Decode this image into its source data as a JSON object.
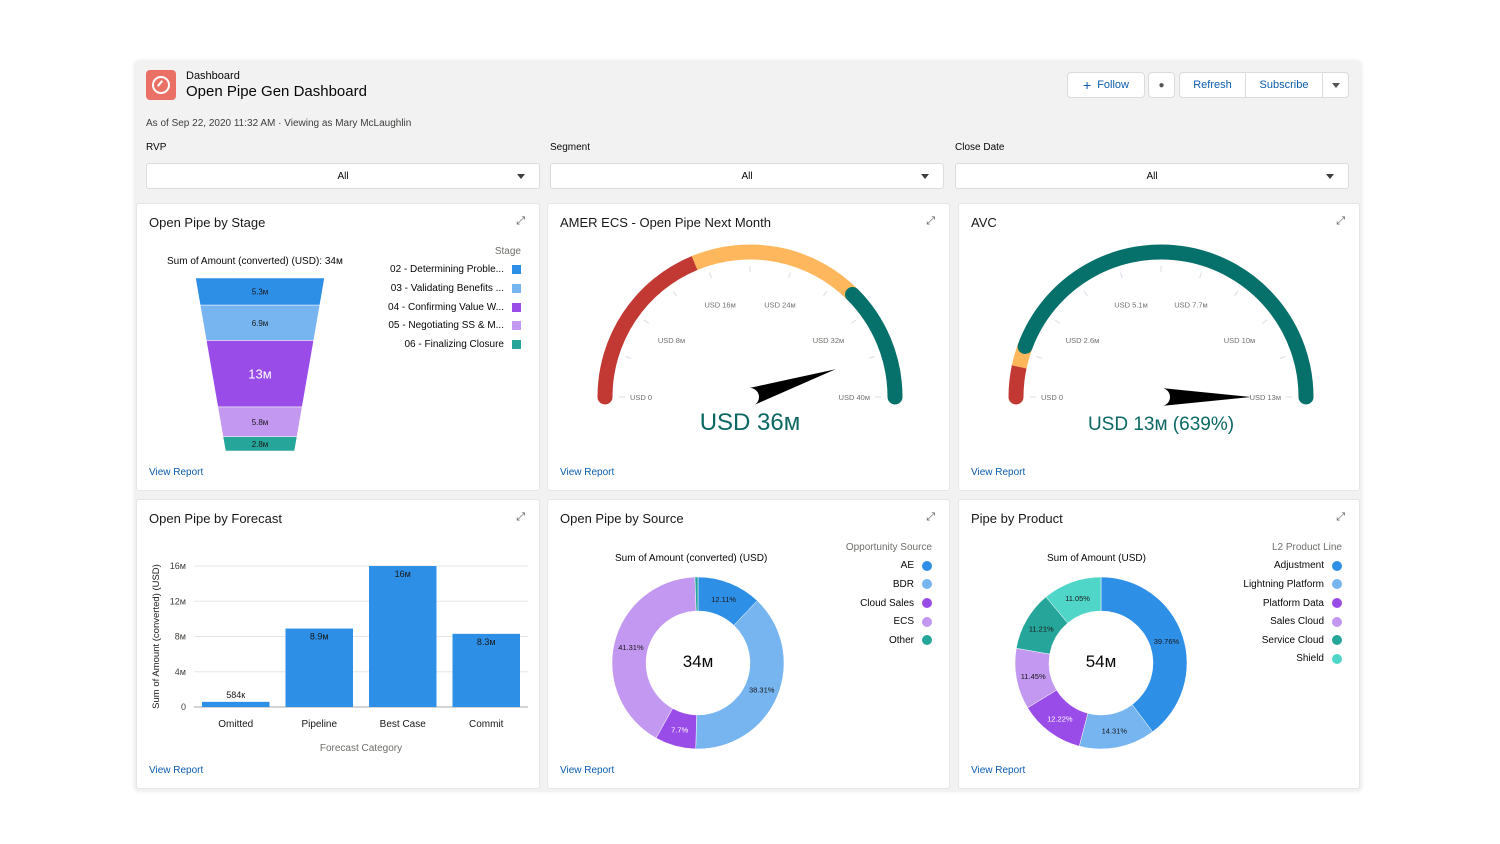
{
  "header": {
    "breadcrumb": "Dashboard",
    "title": "Open Pipe Gen Dashboard",
    "as_of": "As of Sep 22, 2020 11:32 AM · Viewing as Mary McLaughlin",
    "icon": "dashboard-gauge-icon"
  },
  "toolbar": {
    "follow": "Follow",
    "refresh": "Refresh",
    "subscribe": "Subscribe"
  },
  "filters": [
    {
      "label": "RVP",
      "value": "All"
    },
    {
      "label": "Segment",
      "value": "All"
    },
    {
      "label": "Close Date",
      "value": "All"
    }
  ],
  "view_report": "View Report",
  "colors": {
    "blue": "#2e8fe7",
    "light_blue": "#76b5f0",
    "purple": "#9a4ce8",
    "light_purple": "#c398f0",
    "teal": "#26a69a",
    "cyan": "#4fd6c9",
    "red": "#c23934",
    "yellow": "#ffb75d",
    "green": "#06706a",
    "link": "#0b5cab"
  },
  "cards": {
    "stage": {
      "title": "Open Pipe by Stage",
      "subtitle": "Sum of Amount (converted) (USD): 34м",
      "legend_title": "Stage"
    },
    "amer": {
      "title": "AMER ECS - Open Pipe Next Month"
    },
    "avc": {
      "title": "AVC"
    },
    "forecast": {
      "title": "Open Pipe by Forecast"
    },
    "source": {
      "title": "Open Pipe by Source",
      "subtitle": "Sum of Amount (converted) (USD)",
      "legend_title": "Opportunity Source",
      "center": "34м"
    },
    "product": {
      "title": "Pipe by Product",
      "subtitle": "Sum of Amount (USD)",
      "legend_title": "L2 Product Line",
      "center": "54м"
    }
  },
  "chart_data": [
    {
      "type": "funnel",
      "categories": [
        "02 - Determining Proble...",
        "03 - Validating Benefits ...",
        "04 - Confirming Value W...",
        "05 - Negotiating SS & M...",
        "06 - Finalizing Closure"
      ],
      "values": [
        5.3,
        6.9,
        13,
        5.8,
        2.8
      ],
      "labels": [
        "5.3м",
        "6.9м",
        "13м",
        "5.8м",
        "2.8м"
      ],
      "colors": [
        "#2e8fe7",
        "#76b5f0",
        "#9a4ce8",
        "#c398f0",
        "#26a69a"
      ],
      "legend_placement": "right"
    },
    {
      "type": "gauge",
      "min": 0,
      "max": 40,
      "value": 36,
      "value_label": "USD 36м",
      "ticks": [
        "USD 0",
        "USD 8м",
        "USD 16м",
        "USD 24м",
        "USD 32м",
        "USD 40м"
      ],
      "bands": [
        {
          "to": 15,
          "color": "#c23934"
        },
        {
          "to": 30,
          "color": "#ffb75d"
        },
        {
          "to": 40,
          "color": "#06706a"
        }
      ]
    },
    {
      "type": "gauge",
      "min": 0,
      "max": 12.8,
      "value": 12.8,
      "value_label": "USD 13м (639%)",
      "ticks": [
        "USD 0",
        "USD 2.6м",
        "USD 5.1м",
        "USD 7.7м",
        "USD 10м",
        "USD 13м"
      ],
      "bands": [
        {
          "to": 0.85,
          "color": "#c23934"
        },
        {
          "to": 1.45,
          "color": "#ffb75d"
        },
        {
          "to": 12.8,
          "color": "#06706a"
        }
      ]
    },
    {
      "type": "bar",
      "categories": [
        "Omitted",
        "Pipeline",
        "Best Case",
        "Commit"
      ],
      "values": [
        0.584,
        8.9,
        16,
        8.3
      ],
      "labels": [
        "584к",
        "8.9м",
        "16м",
        "8.3м"
      ],
      "xlabel": "Forecast Category",
      "ylabel": "Sum of Amount (converted) (USD)",
      "ylim": [
        0,
        16
      ],
      "yticks": [
        "0",
        "4м",
        "8м",
        "12м",
        "16м"
      ],
      "grid": true,
      "color": "#2e8fe7"
    },
    {
      "type": "pie",
      "categories": [
        "AE",
        "BDR",
        "Cloud Sales",
        "ECS",
        "Other"
      ],
      "values": [
        12.11,
        38.31,
        7.7,
        41.31,
        0.57
      ],
      "labels": [
        "12.11%",
        "38.31%",
        "7.7%",
        "41.31%",
        ""
      ],
      "colors": [
        "#2e8fe7",
        "#76b5f0",
        "#9a4ce8",
        "#c398f0",
        "#26a69a"
      ],
      "legend_placement": "right"
    },
    {
      "type": "pie",
      "categories": [
        "Adjustment",
        "Lightning Platform",
        "Platform Data",
        "Sales Cloud",
        "Service Cloud",
        "Shield"
      ],
      "values": [
        39.76,
        14.31,
        12.22,
        11.45,
        11.21,
        11.05
      ],
      "labels": [
        "39.76%",
        "14.31%",
        "12.22%",
        "11.45%",
        "11.21%",
        "11.05%"
      ],
      "colors": [
        "#2e8fe7",
        "#76b5f0",
        "#9a4ce8",
        "#c398f0",
        "#26a69a",
        "#4fd6c9"
      ],
      "legend_placement": "right"
    }
  ]
}
